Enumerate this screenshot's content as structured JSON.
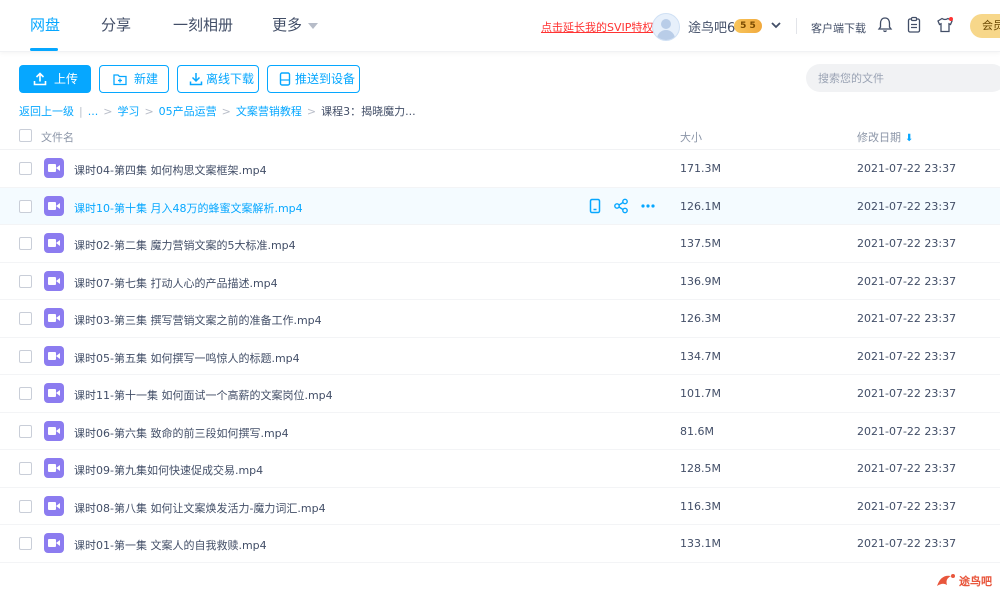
{
  "nav": {
    "tabs": [
      {
        "label": "网盘",
        "active": true
      },
      {
        "label": "分享"
      },
      {
        "label": "一刻相册"
      },
      {
        "label": "更多"
      }
    ],
    "promo": "点击延长我的SVIP特权",
    "username": "途鸟吧6",
    "vip_badge": "5 5",
    "client_download": "客户端下载",
    "vip_button": "会员"
  },
  "toolbar": {
    "upload": "上传",
    "new": "新建",
    "offline": "离线下载",
    "push": "推送到设备",
    "search_placeholder": "搜索您的文件"
  },
  "breadcrumb": {
    "back": "返回上一级",
    "ellipsis": "...",
    "items": [
      "学习",
      "05产品运营",
      "文案营销教程"
    ],
    "current": "课程3：揭晓魔力..."
  },
  "table": {
    "col_name": "文件名",
    "col_size": "大小",
    "col_date": "修改日期",
    "rows": [
      {
        "name": "课时04-第四集 如何构思文案框架.mp4",
        "size": "171.3M",
        "date": "2021-07-22 23:37"
      },
      {
        "name": "课时10-第十集 月入48万的蜂蜜文案解析.mp4",
        "size": "126.1M",
        "date": "2021-07-22 23:37",
        "hover": true
      },
      {
        "name": "课时02-第二集 魔力营销文案的5大标准.mp4",
        "size": "137.5M",
        "date": "2021-07-22 23:37"
      },
      {
        "name": "课时07-第七集 打动人心的产品描述.mp4",
        "size": "136.9M",
        "date": "2021-07-22 23:37"
      },
      {
        "name": "课时03-第三集 撰写营销文案之前的准备工作.mp4",
        "size": "126.3M",
        "date": "2021-07-22 23:37"
      },
      {
        "name": "课时05-第五集 如何撰写一鸣惊人的标题.mp4",
        "size": "134.7M",
        "date": "2021-07-22 23:37"
      },
      {
        "name": "课时11-第十一集 如何面试一个高薪的文案岗位.mp4",
        "size": "101.7M",
        "date": "2021-07-22 23:37"
      },
      {
        "name": "课时06-第六集 致命的前三段如何撰写.mp4",
        "size": "81.6M",
        "date": "2021-07-22 23:37"
      },
      {
        "name": "课时09-第九集如何快速促成交易.mp4",
        "size": "128.5M",
        "date": "2021-07-22 23:37"
      },
      {
        "name": "课时08-第八集 如何让文案焕发活力-魔力词汇.mp4",
        "size": "116.3M",
        "date": "2021-07-22 23:37"
      },
      {
        "name": "课时01-第一集 文案人的自我救赎.mp4",
        "size": "133.1M",
        "date": "2021-07-22 23:37"
      }
    ]
  },
  "watermark": "途鸟吧",
  "colors": {
    "accent": "#06a7ff",
    "video_icon": "#8c7cf0",
    "promo": "#ff3333"
  }
}
